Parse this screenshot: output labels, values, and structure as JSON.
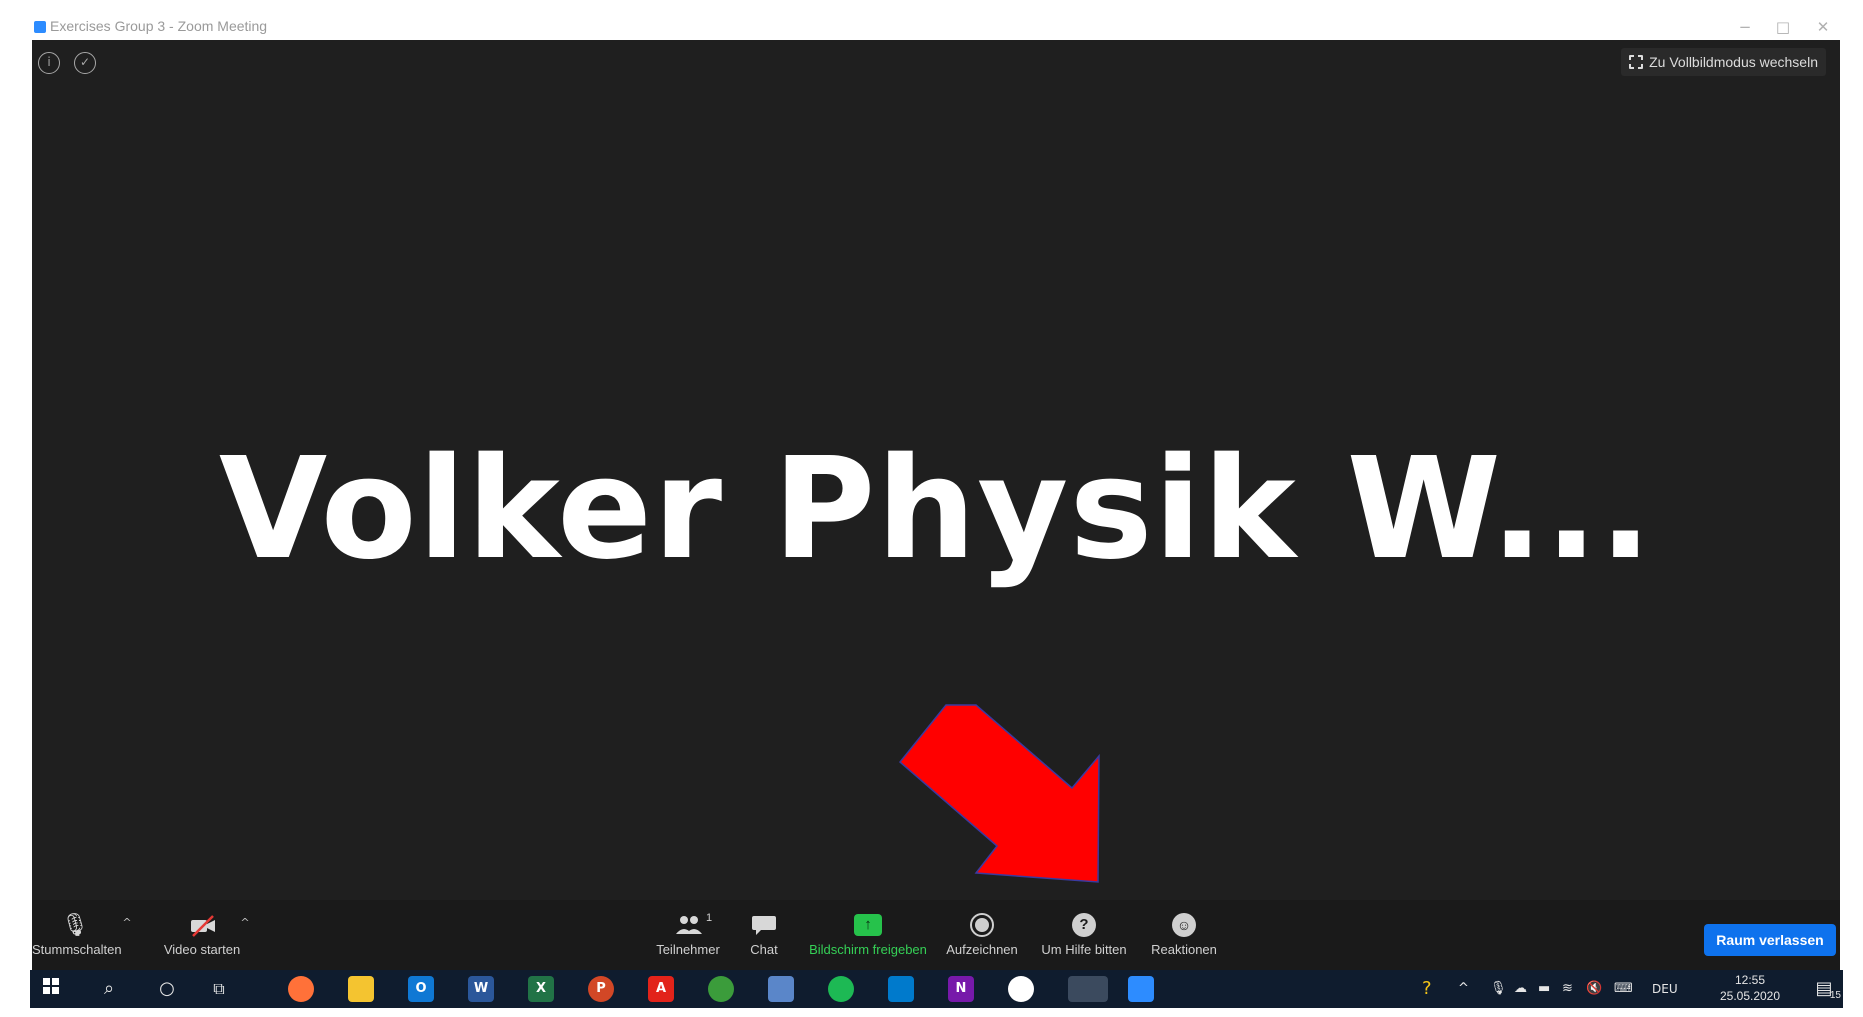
{
  "window": {
    "title": "Exercises Group 3 - Zoom Meeting",
    "controls": [
      "−",
      "□",
      "✕"
    ]
  },
  "meeting": {
    "fullscreen_label": "Zu Vollbildmodus wechseln",
    "participant_name": "Volker Physik W...",
    "icons": [
      "info-icon",
      "shield-icon"
    ]
  },
  "toolbar": {
    "mute_label": "Stummschalten",
    "video_label": "Video starten",
    "participants_label": "Teilnehmer",
    "participants_count": "1",
    "chat_label": "Chat",
    "share_label": "Bildschirm freigeben",
    "record_label": "Aufzeichnen",
    "help_label": "Um Hilfe bitten",
    "reactions_label": "Reaktionen",
    "leave_label": "Raum verlassen",
    "colors": {
      "share": "#35d056",
      "leave": "#0e72ed"
    }
  },
  "taskbar": {
    "language": "DEU",
    "time": "12:55",
    "date": "25.05.2020",
    "notifications": "15",
    "apps": [
      "start",
      "search",
      "cortana",
      "task-view",
      "firefox",
      "file-explorer",
      "outlook",
      "word",
      "excel",
      "powerpoint",
      "acrobat",
      "browser",
      "network",
      "spotify",
      "vscode",
      "onenote",
      "photos",
      "paint",
      "zoom"
    ]
  },
  "annotation": {
    "arrow_color": "#ff0000"
  }
}
